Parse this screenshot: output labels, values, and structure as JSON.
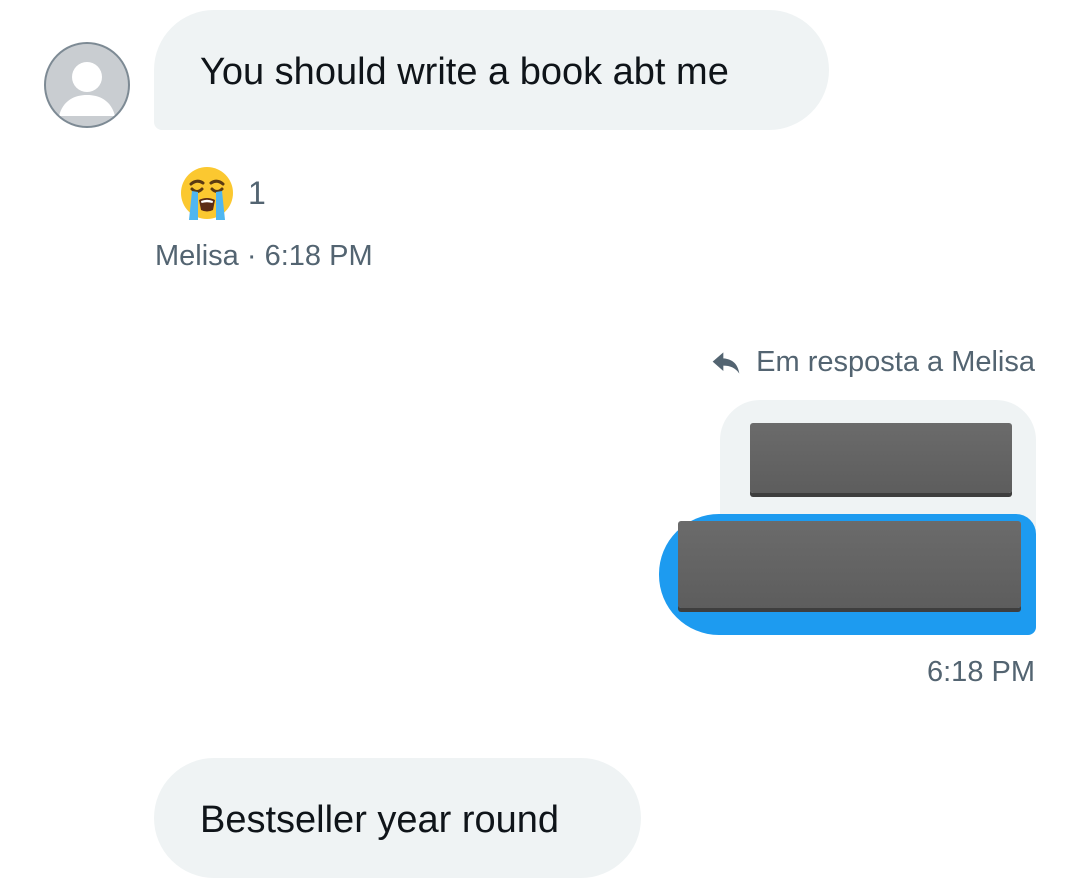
{
  "messages": [
    {
      "direction": "incoming",
      "text": "You should write a book abt me",
      "reaction": {
        "emoji": "loudly-crying-face",
        "count": "1"
      },
      "sender": "Melisa",
      "separator": "·",
      "time": "6:18 PM"
    },
    {
      "direction": "outgoing",
      "reply_label": "Em resposta a Melisa",
      "quoted_text_redacted": true,
      "text_redacted": true,
      "time": "6:18 PM"
    },
    {
      "direction": "incoming",
      "text": "Bestseller year round"
    }
  ],
  "colors": {
    "incoming_bubble": "#eff3f4",
    "outgoing_bubble": "#1d9bf0",
    "meta_text": "#536471",
    "body_text": "#0f1419",
    "redaction": "#5d5d5d"
  }
}
